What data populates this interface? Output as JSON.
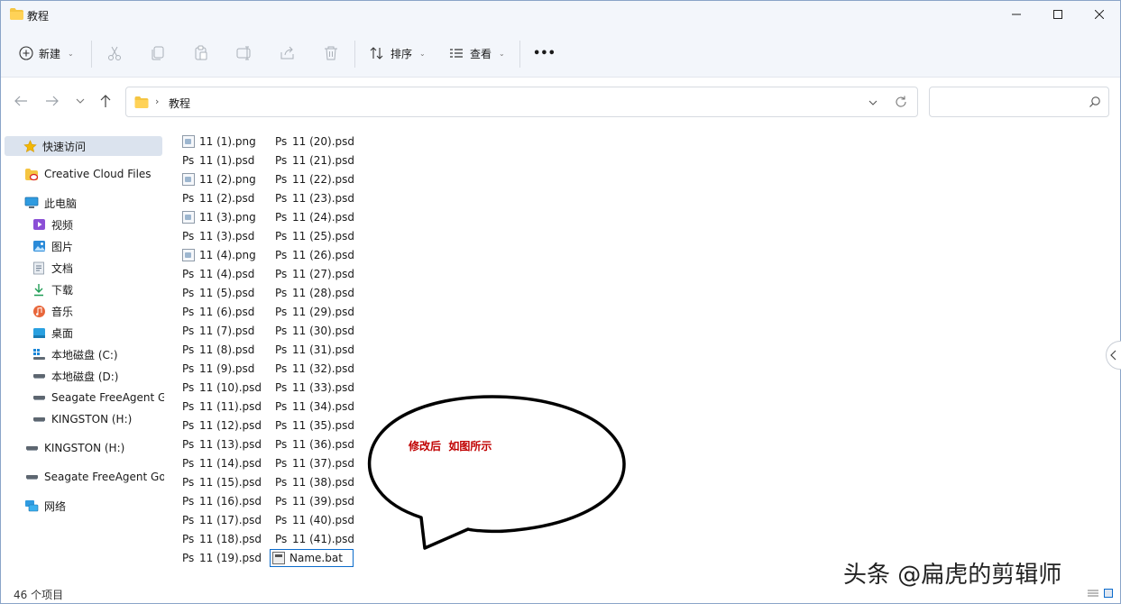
{
  "window": {
    "title": "教程",
    "colors": {
      "chrome": "#f3f6fb",
      "selected": "#dbe3ee",
      "accent": "#0b6bcb",
      "annotation": "#c00000"
    }
  },
  "toolbar": {
    "new_label": "新建",
    "sort_label": "排序",
    "view_label": "查看",
    "more_label": "•••",
    "icons": [
      "cut-icon",
      "copy-icon",
      "paste-icon",
      "rename-icon",
      "share-icon",
      "delete-icon"
    ]
  },
  "address": {
    "crumb": "教程",
    "crumb_separator": "›"
  },
  "search": {
    "placeholder": ""
  },
  "sidebar": {
    "items": [
      {
        "label": "快速访问",
        "icon": "star-icon"
      },
      {
        "label": "Creative Cloud Files",
        "icon": "creative-cloud-folder-icon"
      },
      {
        "label": "此电脑",
        "icon": "computer-icon"
      },
      {
        "label": "视频",
        "icon": "video-icon"
      },
      {
        "label": "图片",
        "icon": "pictures-icon"
      },
      {
        "label": "文档",
        "icon": "documents-icon"
      },
      {
        "label": "下载",
        "icon": "download-icon"
      },
      {
        "label": "音乐",
        "icon": "music-icon"
      },
      {
        "label": "桌面",
        "icon": "desktop-icon"
      },
      {
        "label": "本地磁盘 (C:)",
        "icon": "windows-drive-icon"
      },
      {
        "label": "本地磁盘 (D:)",
        "icon": "drive-icon"
      },
      {
        "label": "Seagate FreeAgent G",
        "icon": "drive-icon"
      },
      {
        "label": "KINGSTON (H:)",
        "icon": "drive-icon"
      },
      {
        "label": "KINGSTON (H:)",
        "icon": "drive-icon"
      },
      {
        "label": "Seagate FreeAgent Go",
        "icon": "drive-icon"
      },
      {
        "label": "网络",
        "icon": "network-icon"
      }
    ]
  },
  "files": {
    "column1": [
      {
        "name": "11 (1).png",
        "type": "png"
      },
      {
        "name": "11 (1).psd",
        "type": "psd"
      },
      {
        "name": "11 (2).png",
        "type": "png"
      },
      {
        "name": "11 (2).psd",
        "type": "psd"
      },
      {
        "name": "11 (3).png",
        "type": "png"
      },
      {
        "name": "11 (3).psd",
        "type": "psd"
      },
      {
        "name": "11 (4).png",
        "type": "png"
      },
      {
        "name": "11 (4).psd",
        "type": "psd"
      },
      {
        "name": "11 (5).psd",
        "type": "psd"
      },
      {
        "name": "11 (6).psd",
        "type": "psd"
      },
      {
        "name": "11 (7).psd",
        "type": "psd"
      },
      {
        "name": "11 (8).psd",
        "type": "psd"
      },
      {
        "name": "11 (9).psd",
        "type": "psd"
      },
      {
        "name": "11 (10).psd",
        "type": "psd"
      },
      {
        "name": "11 (11).psd",
        "type": "psd"
      },
      {
        "name": "11 (12).psd",
        "type": "psd"
      },
      {
        "name": "11 (13).psd",
        "type": "psd"
      },
      {
        "name": "11 (14).psd",
        "type": "psd"
      },
      {
        "name": "11 (15).psd",
        "type": "psd"
      },
      {
        "name": "11 (16).psd",
        "type": "psd"
      },
      {
        "name": "11 (17).psd",
        "type": "psd"
      },
      {
        "name": "11 (18).psd",
        "type": "psd"
      },
      {
        "name": "11 (19).psd",
        "type": "psd"
      }
    ],
    "column2": [
      {
        "name": "11 (20).psd",
        "type": "psd"
      },
      {
        "name": "11 (21).psd",
        "type": "psd"
      },
      {
        "name": "11 (22).psd",
        "type": "psd"
      },
      {
        "name": "11 (23).psd",
        "type": "psd"
      },
      {
        "name": "11 (24).psd",
        "type": "psd"
      },
      {
        "name": "11 (25).psd",
        "type": "psd"
      },
      {
        "name": "11 (26).psd",
        "type": "psd"
      },
      {
        "name": "11 (27).psd",
        "type": "psd"
      },
      {
        "name": "11 (28).psd",
        "type": "psd"
      },
      {
        "name": "11 (29).psd",
        "type": "psd"
      },
      {
        "name": "11 (30).psd",
        "type": "psd"
      },
      {
        "name": "11 (31).psd",
        "type": "psd"
      },
      {
        "name": "11 (32).psd",
        "type": "psd"
      },
      {
        "name": "11 (33).psd",
        "type": "psd"
      },
      {
        "name": "11 (34).psd",
        "type": "psd"
      },
      {
        "name": "11 (35).psd",
        "type": "psd"
      },
      {
        "name": "11 (36).psd",
        "type": "psd"
      },
      {
        "name": "11 (37).psd",
        "type": "psd"
      },
      {
        "name": "11 (38).psd",
        "type": "psd"
      },
      {
        "name": "11 (39).psd",
        "type": "psd"
      },
      {
        "name": "11 (40).psd",
        "type": "psd"
      },
      {
        "name": "11 (41).psd",
        "type": "psd"
      },
      {
        "name": "Name.bat",
        "type": "bat",
        "editing": true
      }
    ]
  },
  "annotation": {
    "text": "修改后  如图所示"
  },
  "status": {
    "count_text": "46 个项目"
  },
  "watermark": {
    "text": "头条 @扁虎的剪辑师"
  }
}
